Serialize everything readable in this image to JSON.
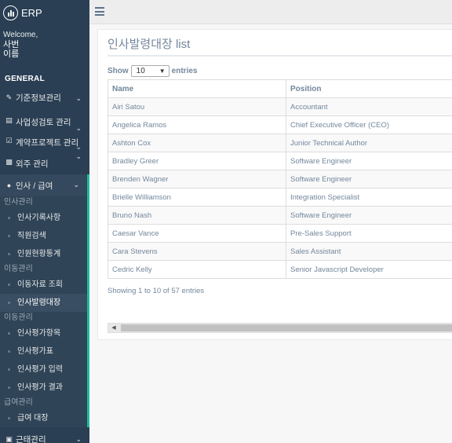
{
  "brand": {
    "name": "ERP"
  },
  "welcome": {
    "greeting": "Welcome,",
    "name_line1": "사번",
    "name_line2": "이름"
  },
  "sidebar": {
    "section": "GENERAL",
    "menus": [
      {
        "label": "기준정보관리",
        "icon": "edit-icon"
      },
      {
        "label": "사업성검토 관리",
        "icon": "briefcase-icon"
      },
      {
        "label": "계약프로젝트 관리",
        "icon": "check-square-icon"
      },
      {
        "label": "외주 관리",
        "icon": "money-icon"
      },
      {
        "label": "인사 / 급여",
        "icon": "user-icon"
      }
    ],
    "groups": [
      {
        "head": "인사관리",
        "items": [
          "인사기록사항",
          "직원검색",
          "인원현황통계"
        ]
      },
      {
        "head": "이동관리",
        "items": [
          "이동자료 조회",
          "인사발령대장"
        ]
      },
      {
        "head": "이동관리",
        "items": [
          "인사평가항목",
          "인사평가표",
          "인사평가 입력",
          "인사평가 결과"
        ]
      },
      {
        "head": "급여관리",
        "items": [
          "급여 대장"
        ]
      }
    ],
    "last_menu": "근태관리"
  },
  "panel": {
    "title": "인사발령대장 list"
  },
  "table": {
    "length_prefix": "Show",
    "length_value": "10",
    "length_suffix": "entries",
    "headers": [
      "Name",
      "Position"
    ],
    "rows": [
      [
        "Airi Satou",
        "Accountant"
      ],
      [
        "Angelica Ramos",
        "Chief Executive Officer (CEO)"
      ],
      [
        "Ashton Cox",
        "Junior Technical Author"
      ],
      [
        "Bradley Greer",
        "Software Engineer"
      ],
      [
        "Brenden Wagner",
        "Software Engineer"
      ],
      [
        "Brielle Williamson",
        "Integration Specialist"
      ],
      [
        "Bruno Nash",
        "Software Engineer"
      ],
      [
        "Caesar Vance",
        "Pre-Sales Support"
      ],
      [
        "Cara Stevens",
        "Sales Assistant"
      ],
      [
        "Cedric Kelly",
        "Senior Javascript Developer"
      ]
    ],
    "info": "Showing 1 to 10 of 57 entries"
  },
  "colors": {
    "sidebar": "#2a3f54",
    "accent": "#1abb9c",
    "text": "#73879c"
  }
}
